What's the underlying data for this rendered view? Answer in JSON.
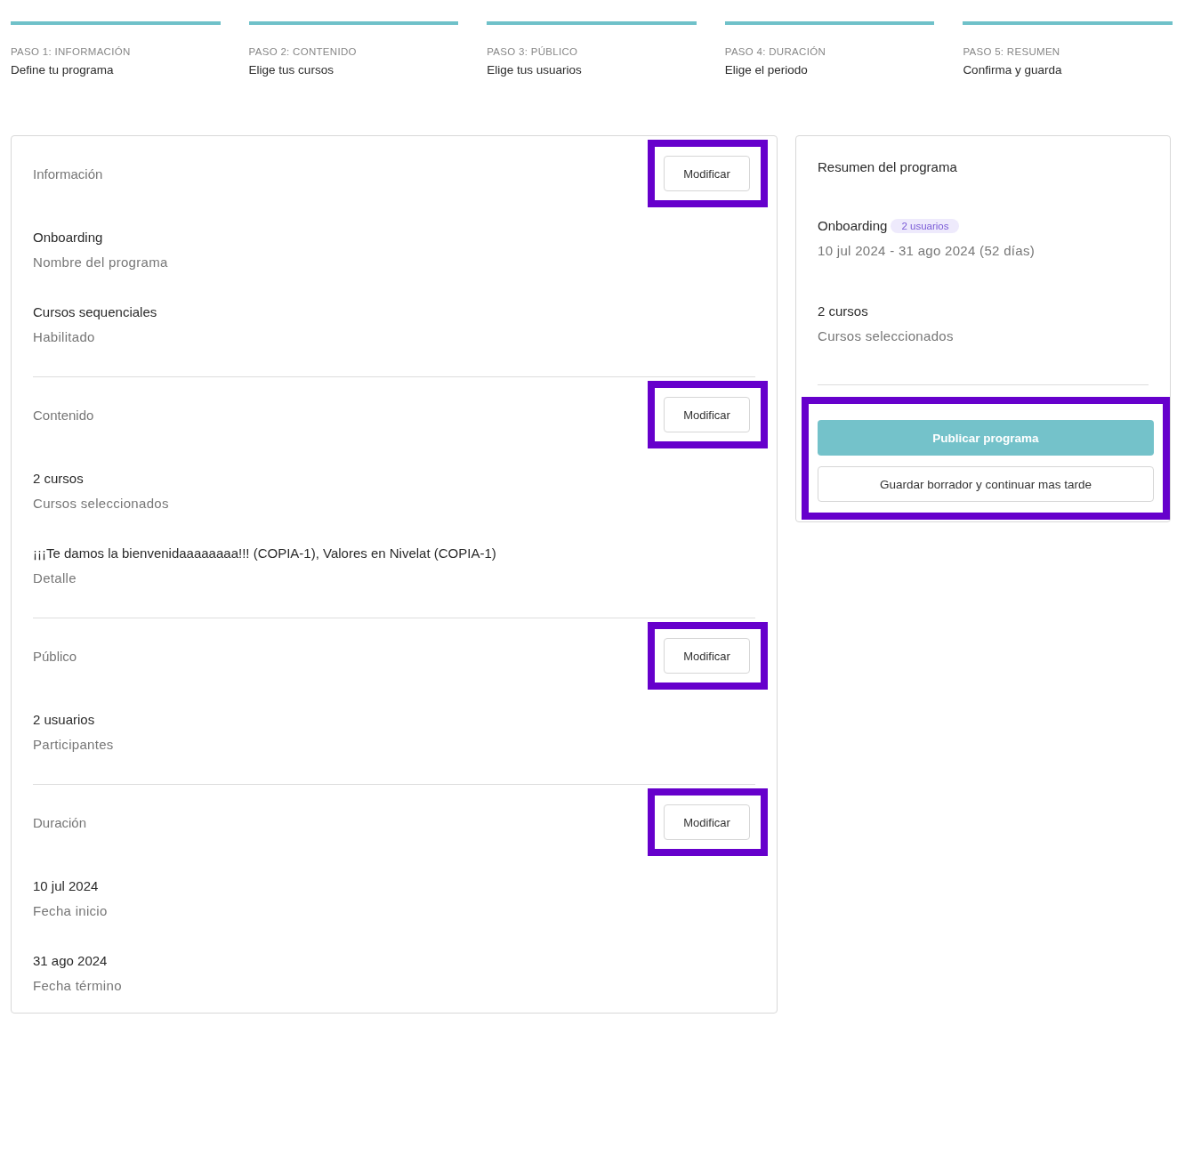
{
  "steps": [
    {
      "label": "PASO 1: INFORMACIÓN",
      "title": "Define tu programa",
      "done": true
    },
    {
      "label": "PASO 2: CONTENIDO",
      "title": "Elige tus cursos",
      "done": true
    },
    {
      "label": "PASO 3: PÚBLICO",
      "title": "Elige tus usuarios",
      "done": true
    },
    {
      "label": "PASO 4: DURACIÓN",
      "title": "Elige el periodo",
      "done": true
    },
    {
      "label": "PASO 5: RESUMEN",
      "title": "Confirma y guarda",
      "done": true
    }
  ],
  "sections": [
    {
      "title": "Información",
      "button": "Modificar",
      "highlighted": true,
      "fields": [
        {
          "value": "Onboarding",
          "label": "Nombre del programa"
        },
        {
          "value": "Cursos sequenciales",
          "label": "Habilitado"
        }
      ]
    },
    {
      "title": "Contenido",
      "button": "Modificar",
      "highlighted": true,
      "fields": [
        {
          "value": "2 cursos",
          "label": "Cursos seleccionados"
        },
        {
          "value": "¡¡¡Te damos la bienvenidaaaaaaaa!!! (COPIA-1), Valores en Nivelat (COPIA-1)",
          "label": "Detalle"
        }
      ]
    },
    {
      "title": "Público",
      "button": "Modificar",
      "highlighted": true,
      "fields": [
        {
          "value": "2 usuarios",
          "label": "Participantes"
        }
      ]
    },
    {
      "title": "Duración",
      "button": "Modificar",
      "highlighted": true,
      "fields": [
        {
          "value": "10 jul 2024",
          "label": "Fecha inicio"
        },
        {
          "value": "31 ago 2024",
          "label": "Fecha término"
        }
      ]
    }
  ],
  "summary": {
    "title": "Resumen del programa",
    "program": "Onboarding",
    "badge": "2 usuarios",
    "dates": "10 jul 2024 - 31 ago 2024 (52 días)",
    "courses": "2 cursos",
    "courses_label": "Cursos seleccionados",
    "actions_highlighted": true,
    "publish_button": "Publicar programa",
    "draft_button": "Guardar borrador y continuar mas tarde"
  }
}
